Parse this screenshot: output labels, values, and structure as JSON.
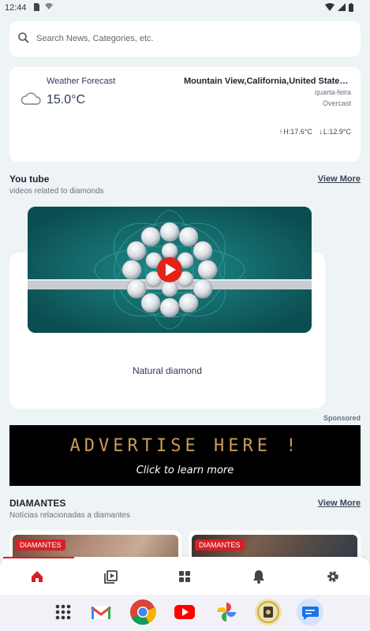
{
  "status_bar": {
    "time": "12:44"
  },
  "search": {
    "placeholder": "Search News, Categories, etc."
  },
  "weather": {
    "title": "Weather Forecast",
    "temperature": "15.0°C",
    "location": "Mountain View,California,United States of America",
    "day": "quarta-feira",
    "condition": "Overcast",
    "high": "H:17.6°C",
    "low": "L:12.9°C"
  },
  "youtube": {
    "title": "You tube",
    "subtitle": "videos related to diamonds",
    "view_more": "View More",
    "video_caption": "Natural diamond"
  },
  "ad": {
    "sponsored": "Sponsored",
    "line1": "ADVERTISE HERE !",
    "line2": "Click to learn more"
  },
  "diamantes": {
    "title": "DIAMANTES",
    "subtitle": "Notícias relacionadas a diamantes",
    "view_more": "View More",
    "cards": [
      {
        "badge": "DIAMANTES"
      },
      {
        "badge": "DIAMANTES"
      }
    ]
  },
  "bottom_nav": [
    "home-icon",
    "video-library-icon",
    "grid-icon",
    "bell-icon",
    "gear-icon"
  ],
  "dock": [
    "app-drawer-icon",
    "gmail-icon",
    "chrome-icon",
    "youtube-icon",
    "photos-icon",
    "app-icon",
    "messages-icon"
  ],
  "colors": {
    "accent": "#d81f26",
    "background": "#eef3f6"
  }
}
